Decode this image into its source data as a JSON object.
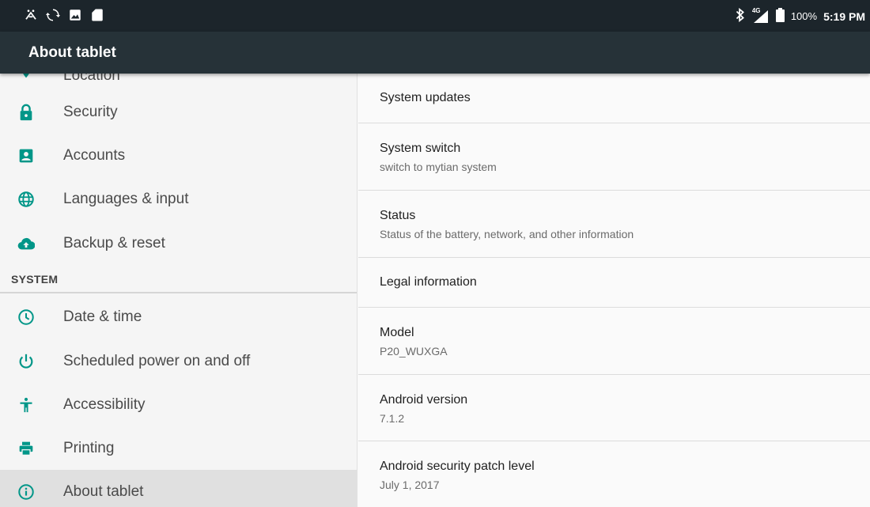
{
  "status_bar": {
    "icons_left": [
      "usb-debug-icon",
      "sync-icon",
      "image-icon",
      "sd-card-icon"
    ],
    "network_label": "4G",
    "battery_percent": "100%",
    "time": "5:19 PM"
  },
  "app_bar": {
    "title": "About tablet"
  },
  "sidebar": {
    "partial_item": {
      "label": "Location",
      "icon": "location-icon"
    },
    "items_personal": [
      {
        "label": "Security",
        "icon": "lock-icon"
      },
      {
        "label": "Accounts",
        "icon": "account-box-icon"
      },
      {
        "label": "Languages & input",
        "icon": "globe-icon"
      },
      {
        "label": "Backup & reset",
        "icon": "cloud-upload-icon"
      }
    ],
    "section_system": "SYSTEM",
    "items_system": [
      {
        "label": "Date & time",
        "icon": "clock-icon"
      },
      {
        "label": "Scheduled power on and off",
        "icon": "power-icon"
      },
      {
        "label": "Accessibility",
        "icon": "accessibility-icon"
      },
      {
        "label": "Printing",
        "icon": "printer-icon"
      },
      {
        "label": "About tablet",
        "icon": "info-icon",
        "selected": true
      }
    ]
  },
  "content": {
    "rows": [
      {
        "title": "System updates",
        "summary": ""
      },
      {
        "title": "System switch",
        "summary": "switch to mytian system"
      },
      {
        "title": "Status",
        "summary": "Status of the battery, network, and other information"
      },
      {
        "title": "Legal information",
        "summary": ""
      },
      {
        "title": "Model",
        "summary": "P20_WUXGA"
      },
      {
        "title": "Android version",
        "summary": "7.1.2"
      },
      {
        "title": "Android security patch level",
        "summary": "July 1, 2017"
      }
    ]
  },
  "colors": {
    "status_bar": "#1c252b",
    "app_bar": "#263238",
    "accent": "#009688",
    "selected_bg": "#e0e0e0"
  }
}
